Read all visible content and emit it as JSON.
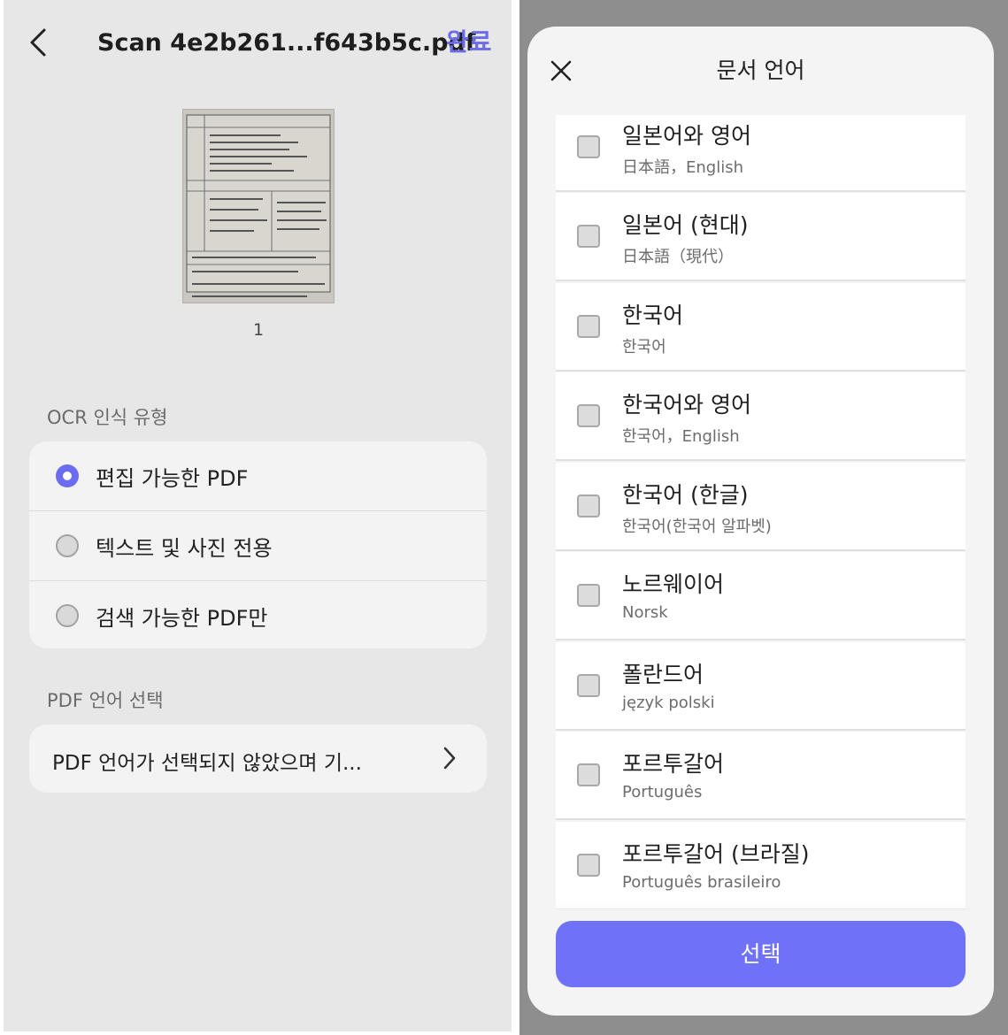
{
  "header": {
    "title": "Scan 4e2b261...f643b5c.pdf",
    "done_label": "완료"
  },
  "preview": {
    "page_number": "1"
  },
  "ocr": {
    "section_label": "OCR 인식 유형",
    "options": [
      {
        "label": "편집 가능한 PDF",
        "selected": true
      },
      {
        "label": "텍스트 및 사진 전용",
        "selected": false
      },
      {
        "label": "검색 가능한 PDF만",
        "selected": false
      }
    ]
  },
  "pdf_language": {
    "section_label": "PDF 언어 선택",
    "value": "PDF 언어가 선택되지 않았으며 기..."
  },
  "sheet": {
    "title": "문서 언어",
    "languages": [
      {
        "name": "일본어와 영어",
        "native": "日本語，English",
        "checked": false
      },
      {
        "name": "일본어 (현대)",
        "native": "日本語（現代）",
        "checked": false
      },
      {
        "name": "한국어",
        "native": "한국어",
        "checked": false
      },
      {
        "name": "한국어와 영어",
        "native": "한국어，English",
        "checked": false
      },
      {
        "name": "한국어 (한글)",
        "native": "한국어(한국어 알파벳)",
        "checked": false
      },
      {
        "name": "노르웨이어",
        "native": "Norsk",
        "checked": false
      },
      {
        "name": "폴란드어",
        "native": "język polski",
        "checked": false
      },
      {
        "name": "포르투갈어",
        "native": "Português",
        "checked": false
      },
      {
        "name": "포르투갈어 (브라질)",
        "native": "Português brasileiro",
        "checked": false
      }
    ],
    "select_label": "선택"
  },
  "colors": {
    "accent": "#6c6cf2",
    "button": "#6f72f7"
  },
  "icons": [
    "back-arrow-icon",
    "chevron-right-icon",
    "close-icon",
    "radio-icon",
    "checkbox-icon"
  ]
}
